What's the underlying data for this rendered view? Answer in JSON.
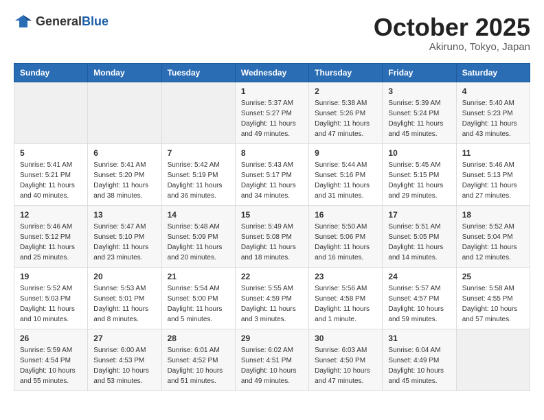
{
  "logo": {
    "general": "General",
    "blue": "Blue"
  },
  "title": "October 2025",
  "location": "Akiruno, Tokyo, Japan",
  "weekdays": [
    "Sunday",
    "Monday",
    "Tuesday",
    "Wednesday",
    "Thursday",
    "Friday",
    "Saturday"
  ],
  "weeks": [
    [
      {
        "day": "",
        "sunrise": "",
        "sunset": "",
        "daylight": ""
      },
      {
        "day": "",
        "sunrise": "",
        "sunset": "",
        "daylight": ""
      },
      {
        "day": "",
        "sunrise": "",
        "sunset": "",
        "daylight": ""
      },
      {
        "day": "1",
        "sunrise": "Sunrise: 5:37 AM",
        "sunset": "Sunset: 5:27 PM",
        "daylight": "Daylight: 11 hours and 49 minutes."
      },
      {
        "day": "2",
        "sunrise": "Sunrise: 5:38 AM",
        "sunset": "Sunset: 5:26 PM",
        "daylight": "Daylight: 11 hours and 47 minutes."
      },
      {
        "day": "3",
        "sunrise": "Sunrise: 5:39 AM",
        "sunset": "Sunset: 5:24 PM",
        "daylight": "Daylight: 11 hours and 45 minutes."
      },
      {
        "day": "4",
        "sunrise": "Sunrise: 5:40 AM",
        "sunset": "Sunset: 5:23 PM",
        "daylight": "Daylight: 11 hours and 43 minutes."
      }
    ],
    [
      {
        "day": "5",
        "sunrise": "Sunrise: 5:41 AM",
        "sunset": "Sunset: 5:21 PM",
        "daylight": "Daylight: 11 hours and 40 minutes."
      },
      {
        "day": "6",
        "sunrise": "Sunrise: 5:41 AM",
        "sunset": "Sunset: 5:20 PM",
        "daylight": "Daylight: 11 hours and 38 minutes."
      },
      {
        "day": "7",
        "sunrise": "Sunrise: 5:42 AM",
        "sunset": "Sunset: 5:19 PM",
        "daylight": "Daylight: 11 hours and 36 minutes."
      },
      {
        "day": "8",
        "sunrise": "Sunrise: 5:43 AM",
        "sunset": "Sunset: 5:17 PM",
        "daylight": "Daylight: 11 hours and 34 minutes."
      },
      {
        "day": "9",
        "sunrise": "Sunrise: 5:44 AM",
        "sunset": "Sunset: 5:16 PM",
        "daylight": "Daylight: 11 hours and 31 minutes."
      },
      {
        "day": "10",
        "sunrise": "Sunrise: 5:45 AM",
        "sunset": "Sunset: 5:15 PM",
        "daylight": "Daylight: 11 hours and 29 minutes."
      },
      {
        "day": "11",
        "sunrise": "Sunrise: 5:46 AM",
        "sunset": "Sunset: 5:13 PM",
        "daylight": "Daylight: 11 hours and 27 minutes."
      }
    ],
    [
      {
        "day": "12",
        "sunrise": "Sunrise: 5:46 AM",
        "sunset": "Sunset: 5:12 PM",
        "daylight": "Daylight: 11 hours and 25 minutes."
      },
      {
        "day": "13",
        "sunrise": "Sunrise: 5:47 AM",
        "sunset": "Sunset: 5:10 PM",
        "daylight": "Daylight: 11 hours and 23 minutes."
      },
      {
        "day": "14",
        "sunrise": "Sunrise: 5:48 AM",
        "sunset": "Sunset: 5:09 PM",
        "daylight": "Daylight: 11 hours and 20 minutes."
      },
      {
        "day": "15",
        "sunrise": "Sunrise: 5:49 AM",
        "sunset": "Sunset: 5:08 PM",
        "daylight": "Daylight: 11 hours and 18 minutes."
      },
      {
        "day": "16",
        "sunrise": "Sunrise: 5:50 AM",
        "sunset": "Sunset: 5:06 PM",
        "daylight": "Daylight: 11 hours and 16 minutes."
      },
      {
        "day": "17",
        "sunrise": "Sunrise: 5:51 AM",
        "sunset": "Sunset: 5:05 PM",
        "daylight": "Daylight: 11 hours and 14 minutes."
      },
      {
        "day": "18",
        "sunrise": "Sunrise: 5:52 AM",
        "sunset": "Sunset: 5:04 PM",
        "daylight": "Daylight: 11 hours and 12 minutes."
      }
    ],
    [
      {
        "day": "19",
        "sunrise": "Sunrise: 5:52 AM",
        "sunset": "Sunset: 5:03 PM",
        "daylight": "Daylight: 11 hours and 10 minutes."
      },
      {
        "day": "20",
        "sunrise": "Sunrise: 5:53 AM",
        "sunset": "Sunset: 5:01 PM",
        "daylight": "Daylight: 11 hours and 8 minutes."
      },
      {
        "day": "21",
        "sunrise": "Sunrise: 5:54 AM",
        "sunset": "Sunset: 5:00 PM",
        "daylight": "Daylight: 11 hours and 5 minutes."
      },
      {
        "day": "22",
        "sunrise": "Sunrise: 5:55 AM",
        "sunset": "Sunset: 4:59 PM",
        "daylight": "Daylight: 11 hours and 3 minutes."
      },
      {
        "day": "23",
        "sunrise": "Sunrise: 5:56 AM",
        "sunset": "Sunset: 4:58 PM",
        "daylight": "Daylight: 11 hours and 1 minute."
      },
      {
        "day": "24",
        "sunrise": "Sunrise: 5:57 AM",
        "sunset": "Sunset: 4:57 PM",
        "daylight": "Daylight: 10 hours and 59 minutes."
      },
      {
        "day": "25",
        "sunrise": "Sunrise: 5:58 AM",
        "sunset": "Sunset: 4:55 PM",
        "daylight": "Daylight: 10 hours and 57 minutes."
      }
    ],
    [
      {
        "day": "26",
        "sunrise": "Sunrise: 5:59 AM",
        "sunset": "Sunset: 4:54 PM",
        "daylight": "Daylight: 10 hours and 55 minutes."
      },
      {
        "day": "27",
        "sunrise": "Sunrise: 6:00 AM",
        "sunset": "Sunset: 4:53 PM",
        "daylight": "Daylight: 10 hours and 53 minutes."
      },
      {
        "day": "28",
        "sunrise": "Sunrise: 6:01 AM",
        "sunset": "Sunset: 4:52 PM",
        "daylight": "Daylight: 10 hours and 51 minutes."
      },
      {
        "day": "29",
        "sunrise": "Sunrise: 6:02 AM",
        "sunset": "Sunset: 4:51 PM",
        "daylight": "Daylight: 10 hours and 49 minutes."
      },
      {
        "day": "30",
        "sunrise": "Sunrise: 6:03 AM",
        "sunset": "Sunset: 4:50 PM",
        "daylight": "Daylight: 10 hours and 47 minutes."
      },
      {
        "day": "31",
        "sunrise": "Sunrise: 6:04 AM",
        "sunset": "Sunset: 4:49 PM",
        "daylight": "Daylight: 10 hours and 45 minutes."
      },
      {
        "day": "",
        "sunrise": "",
        "sunset": "",
        "daylight": ""
      }
    ]
  ]
}
